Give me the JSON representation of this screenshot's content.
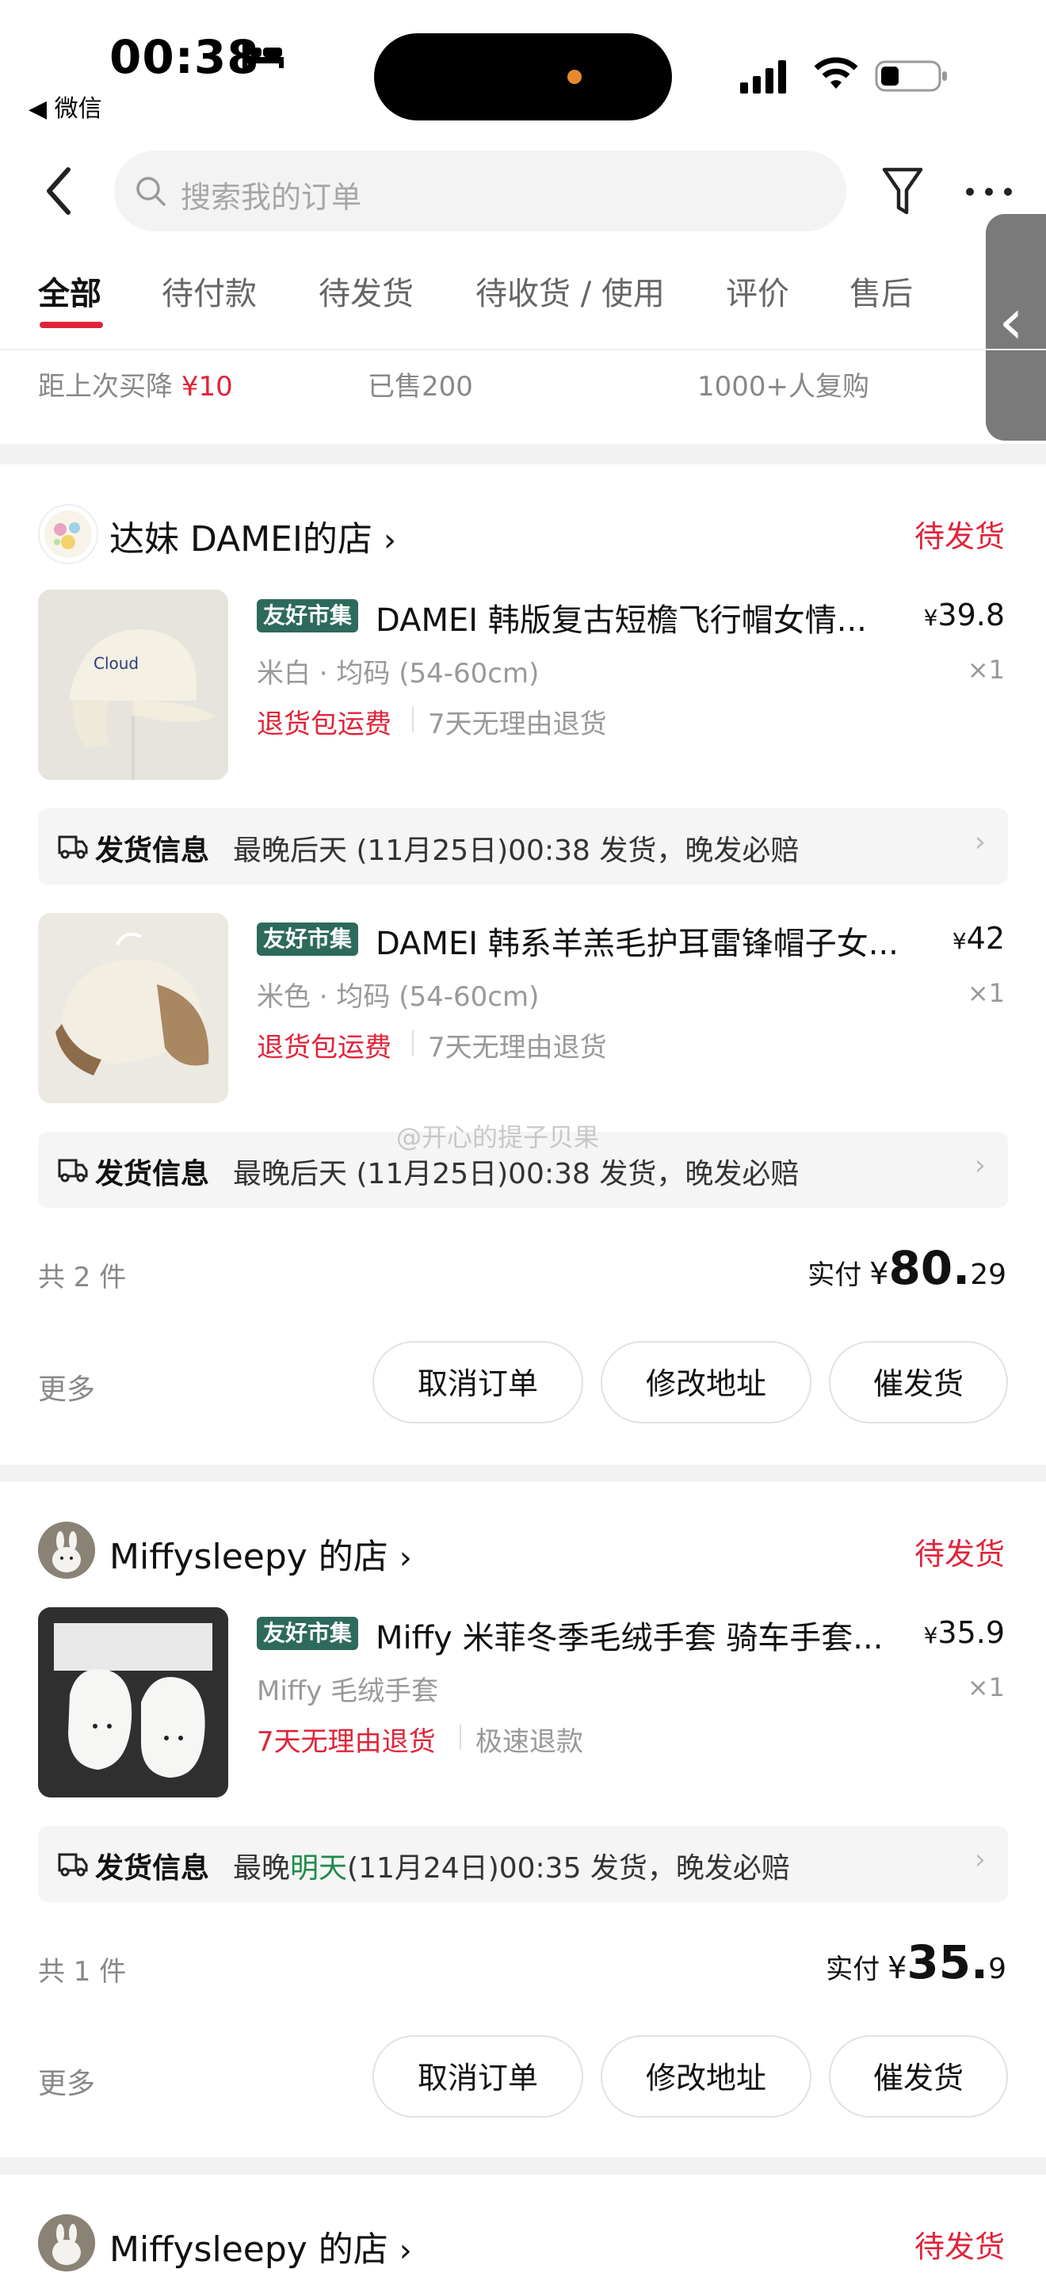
{
  "status_bar": {
    "time": "00:38",
    "back_app": "◀ 微信"
  },
  "search": {
    "placeholder": "搜索我的订单"
  },
  "tabs": [
    {
      "label": "全部",
      "active": true
    },
    {
      "label": "待付款"
    },
    {
      "label": "待发货"
    },
    {
      "label": "待收货 / 使用"
    },
    {
      "label": "评价"
    },
    {
      "label": "售后"
    }
  ],
  "stats": {
    "price_drop_label": "距上次买降",
    "price_drop_value": "¥10",
    "sold": "已售200",
    "repurchase": "1000+人复购"
  },
  "orders": [
    {
      "shop": "达妹 DAMEI的店",
      "status": "待发货",
      "items": [
        {
          "badge": "友好市集",
          "title": "DAMEI 韩版复古短檐飞行帽女情...",
          "price_symbol": "¥",
          "price": "39.8",
          "spec": "米白 · 均码 (54-60cm)",
          "qty": "×1",
          "tag_red": "退货包运费",
          "tag_gray": "7天无理由退货",
          "ship_label": "发货信息",
          "ship_text": "最晚后天 (11月25日)00:38 发货，晚发必赔"
        },
        {
          "badge": "友好市集",
          "title": "DAMEI 韩系羊羔毛护耳雷锋帽子女...",
          "price_symbol": "¥",
          "price": "42",
          "spec": "米色 · 均码 (54-60cm)",
          "qty": "×1",
          "tag_red": "退货包运费",
          "tag_gray": "7天无理由退货",
          "ship_label": "发货信息",
          "ship_text": "最晚后天 (11月25日)00:38 发货，晚发必赔"
        }
      ],
      "count": "共 2 件",
      "paid_label": "实付",
      "paid_symbol": "¥",
      "paid_int": "80.",
      "paid_dec": "29",
      "more": "更多",
      "buttons": [
        "取消订单",
        "修改地址",
        "催发货"
      ]
    },
    {
      "shop": "Miffysleepy 的店",
      "status": "待发货",
      "items": [
        {
          "badge": "友好市集",
          "title": "Miffy 米菲冬季毛绒手套 骑车手套...",
          "price_symbol": "¥",
          "price": "35.9",
          "spec": "Miffy 毛绒手套",
          "qty": "×1",
          "tag_red": "7天无理由退货",
          "tag_gray": "极速退款",
          "ship_label": "发货信息",
          "ship_pre": "最晚",
          "ship_green": "明天",
          "ship_post": "(11月24日)00:35 发货，晚发必赔"
        }
      ],
      "count": "共 1 件",
      "paid_label": "实付",
      "paid_symbol": "¥",
      "paid_int": "35.",
      "paid_dec": "9",
      "more": "更多",
      "buttons": [
        "取消订单",
        "修改地址",
        "催发货"
      ]
    },
    {
      "shop": "Miffysleepy 的店",
      "status": "待发货"
    }
  ],
  "watermark": "@开心的提子贝果",
  "colors": {
    "accent_red": "#e0243a",
    "badge_green": "#2d6a5c",
    "ship_green": "#1f8a4c"
  }
}
